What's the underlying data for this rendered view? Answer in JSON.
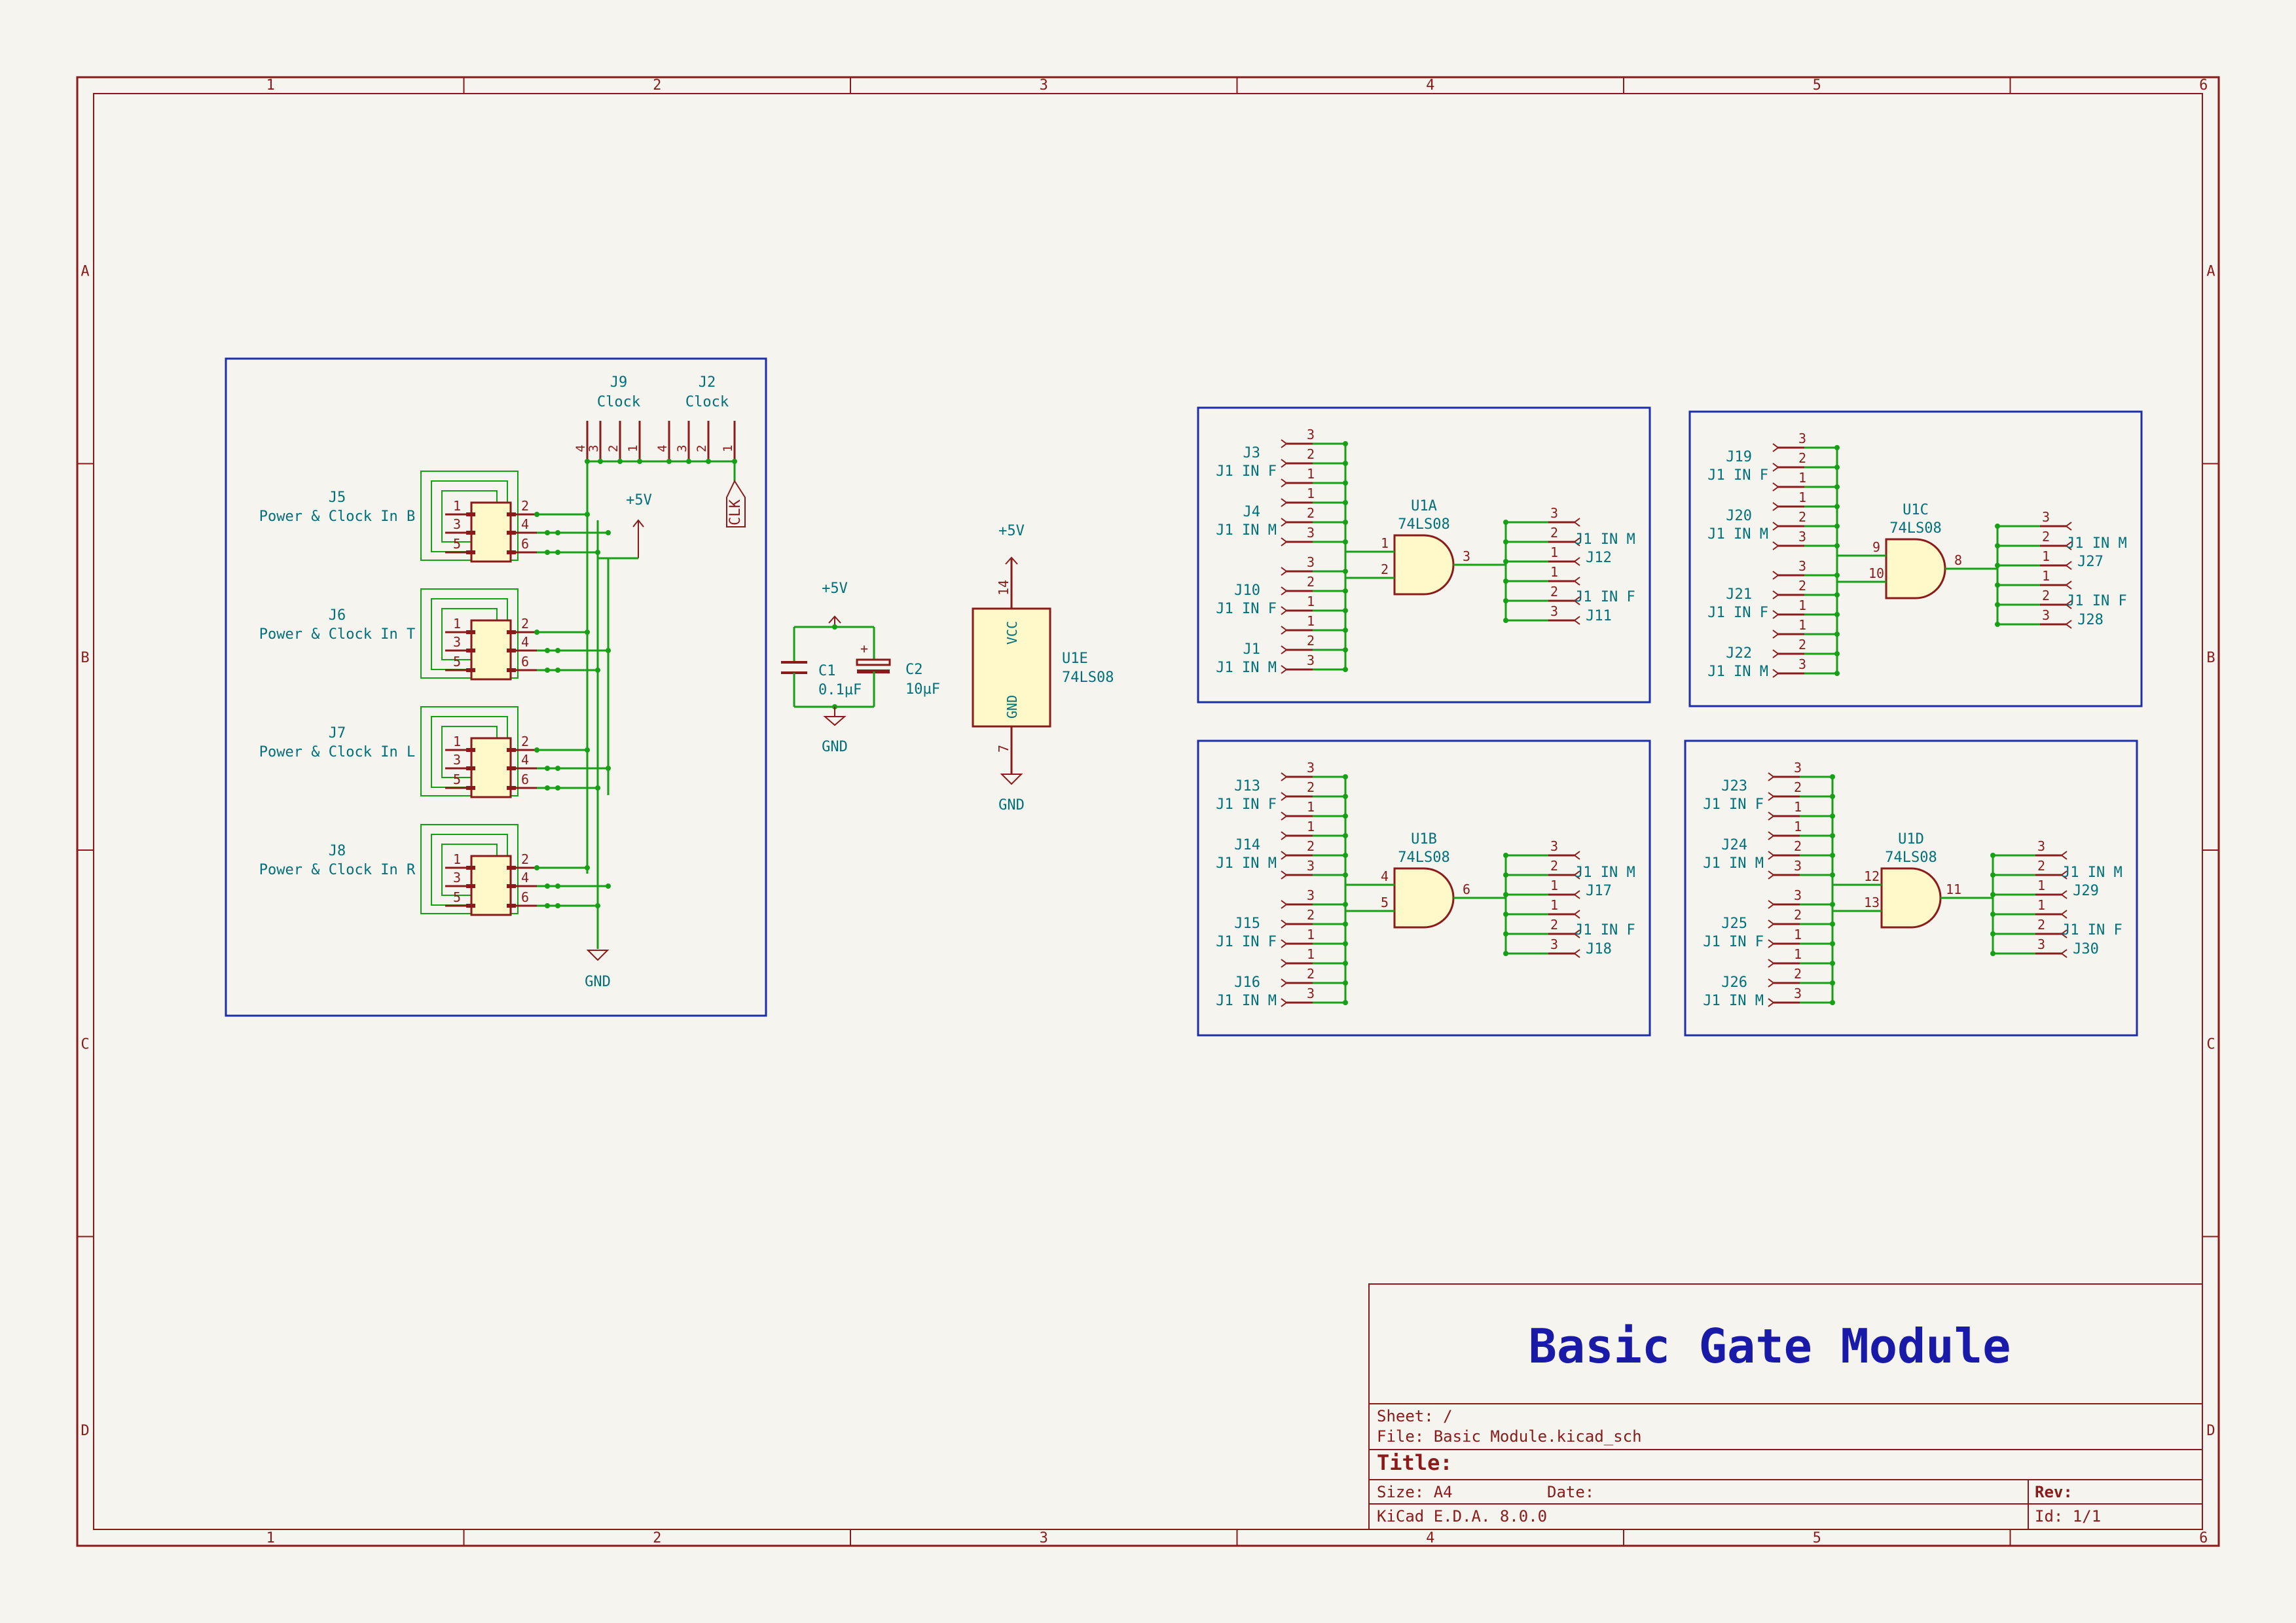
{
  "border": {
    "columns": [
      "1",
      "2",
      "3",
      "4",
      "5",
      "6"
    ],
    "rows": [
      "A",
      "B",
      "C",
      "D"
    ]
  },
  "title_block": {
    "main_title": "Basic Gate Module",
    "sheet": "Sheet: /",
    "file": "File: Basic Module.kicad_sch",
    "title_label": "Title:",
    "size": "Size: A4",
    "date": "Date:",
    "rev": "Rev:",
    "kicad": "KiCad E.D.A. 8.0.0",
    "id": "Id: 1/1"
  },
  "power_section": {
    "j9": {
      "ref": "J9",
      "value": "Clock",
      "pins": [
        "4",
        "3",
        "2",
        "1"
      ]
    },
    "j2": {
      "ref": "J2",
      "value": "Clock",
      "pins": [
        "4",
        "3",
        "2",
        "1"
      ]
    },
    "clk_label": "CLK",
    "vcc_label": "+5V",
    "gnd_label": "GND",
    "connectors": [
      {
        "ref": "J5",
        "value": "Power & Clock In B"
      },
      {
        "ref": "J6",
        "value": "Power & Clock In T"
      },
      {
        "ref": "J7",
        "value": "Power & Clock In L"
      },
      {
        "ref": "J8",
        "value": "Power & Clock In R"
      }
    ],
    "conn_pins": [
      "1",
      "2",
      "3",
      "4",
      "5",
      "6"
    ]
  },
  "decoupling": {
    "vcc": "+5V",
    "gnd": "GND",
    "c1": {
      "ref": "C1",
      "value": "0.1µF"
    },
    "c2": {
      "ref": "C2",
      "value": "10µF"
    },
    "plus": "+"
  },
  "power_unit": {
    "ref": "U1E",
    "value": "74LS08",
    "vcc_pin_name": "VCC",
    "gnd_pin_name": "GND",
    "vcc_pin": "14",
    "gnd_pin": "7",
    "vcc": "+5V",
    "gnd": "GND"
  },
  "pin_numbers": [
    "3",
    "2",
    "1",
    "1",
    "2",
    "3"
  ],
  "gates": [
    {
      "ref": "U1A",
      "value": "74LS08",
      "in_a": "1",
      "in_b": "2",
      "out": "3",
      "in_conns": [
        {
          "ref": "J3",
          "value": "J1 IN F"
        },
        {
          "ref": "J4",
          "value": "J1 IN M"
        },
        {
          "ref": "J10",
          "value": "J1 IN F"
        },
        {
          "ref": "J1",
          "value": "J1 IN M"
        }
      ],
      "out_conns": [
        {
          "ref": "J12",
          "value": "J1 IN M"
        },
        {
          "ref": "J11",
          "value": "J1 IN F"
        }
      ]
    },
    {
      "ref": "U1C",
      "value": "74LS08",
      "in_a": "9",
      "in_b": "10",
      "out": "8",
      "in_conns": [
        {
          "ref": "J19",
          "value": "J1 IN F"
        },
        {
          "ref": "J20",
          "value": "J1 IN M"
        },
        {
          "ref": "J21",
          "value": "J1 IN F"
        },
        {
          "ref": "J22",
          "value": "J1 IN M"
        }
      ],
      "out_conns": [
        {
          "ref": "J27",
          "value": "J1 IN M"
        },
        {
          "ref": "J28",
          "value": "J1 IN F"
        }
      ]
    },
    {
      "ref": "U1B",
      "value": "74LS08",
      "in_a": "4",
      "in_b": "5",
      "out": "6",
      "in_conns": [
        {
          "ref": "J13",
          "value": "J1 IN F"
        },
        {
          "ref": "J14",
          "value": "J1 IN M"
        },
        {
          "ref": "J15",
          "value": "J1 IN F"
        },
        {
          "ref": "J16",
          "value": "J1 IN M"
        }
      ],
      "out_conns": [
        {
          "ref": "J17",
          "value": "J1 IN M"
        },
        {
          "ref": "J18",
          "value": "J1 IN F"
        }
      ]
    },
    {
      "ref": "U1D",
      "value": "74LS08",
      "in_a": "12",
      "in_b": "13",
      "out": "11",
      "in_conns": [
        {
          "ref": "J23",
          "value": "J1 IN F"
        },
        {
          "ref": "J24",
          "value": "J1 IN M"
        },
        {
          "ref": "J25",
          "value": "J1 IN F"
        },
        {
          "ref": "J26",
          "value": "J1 IN M"
        }
      ],
      "out_conns": [
        {
          "ref": "J29",
          "value": "J1 IN M"
        },
        {
          "ref": "J30",
          "value": "J1 IN F"
        }
      ]
    }
  ],
  "colors": {
    "frame": "#8b1a1a",
    "wire": "#16a016",
    "box": "#1c2ea8",
    "ref_text": "#00707a",
    "pin": "#8b1a1a",
    "body": "#fff8c8",
    "title": "#1a1aa8"
  }
}
